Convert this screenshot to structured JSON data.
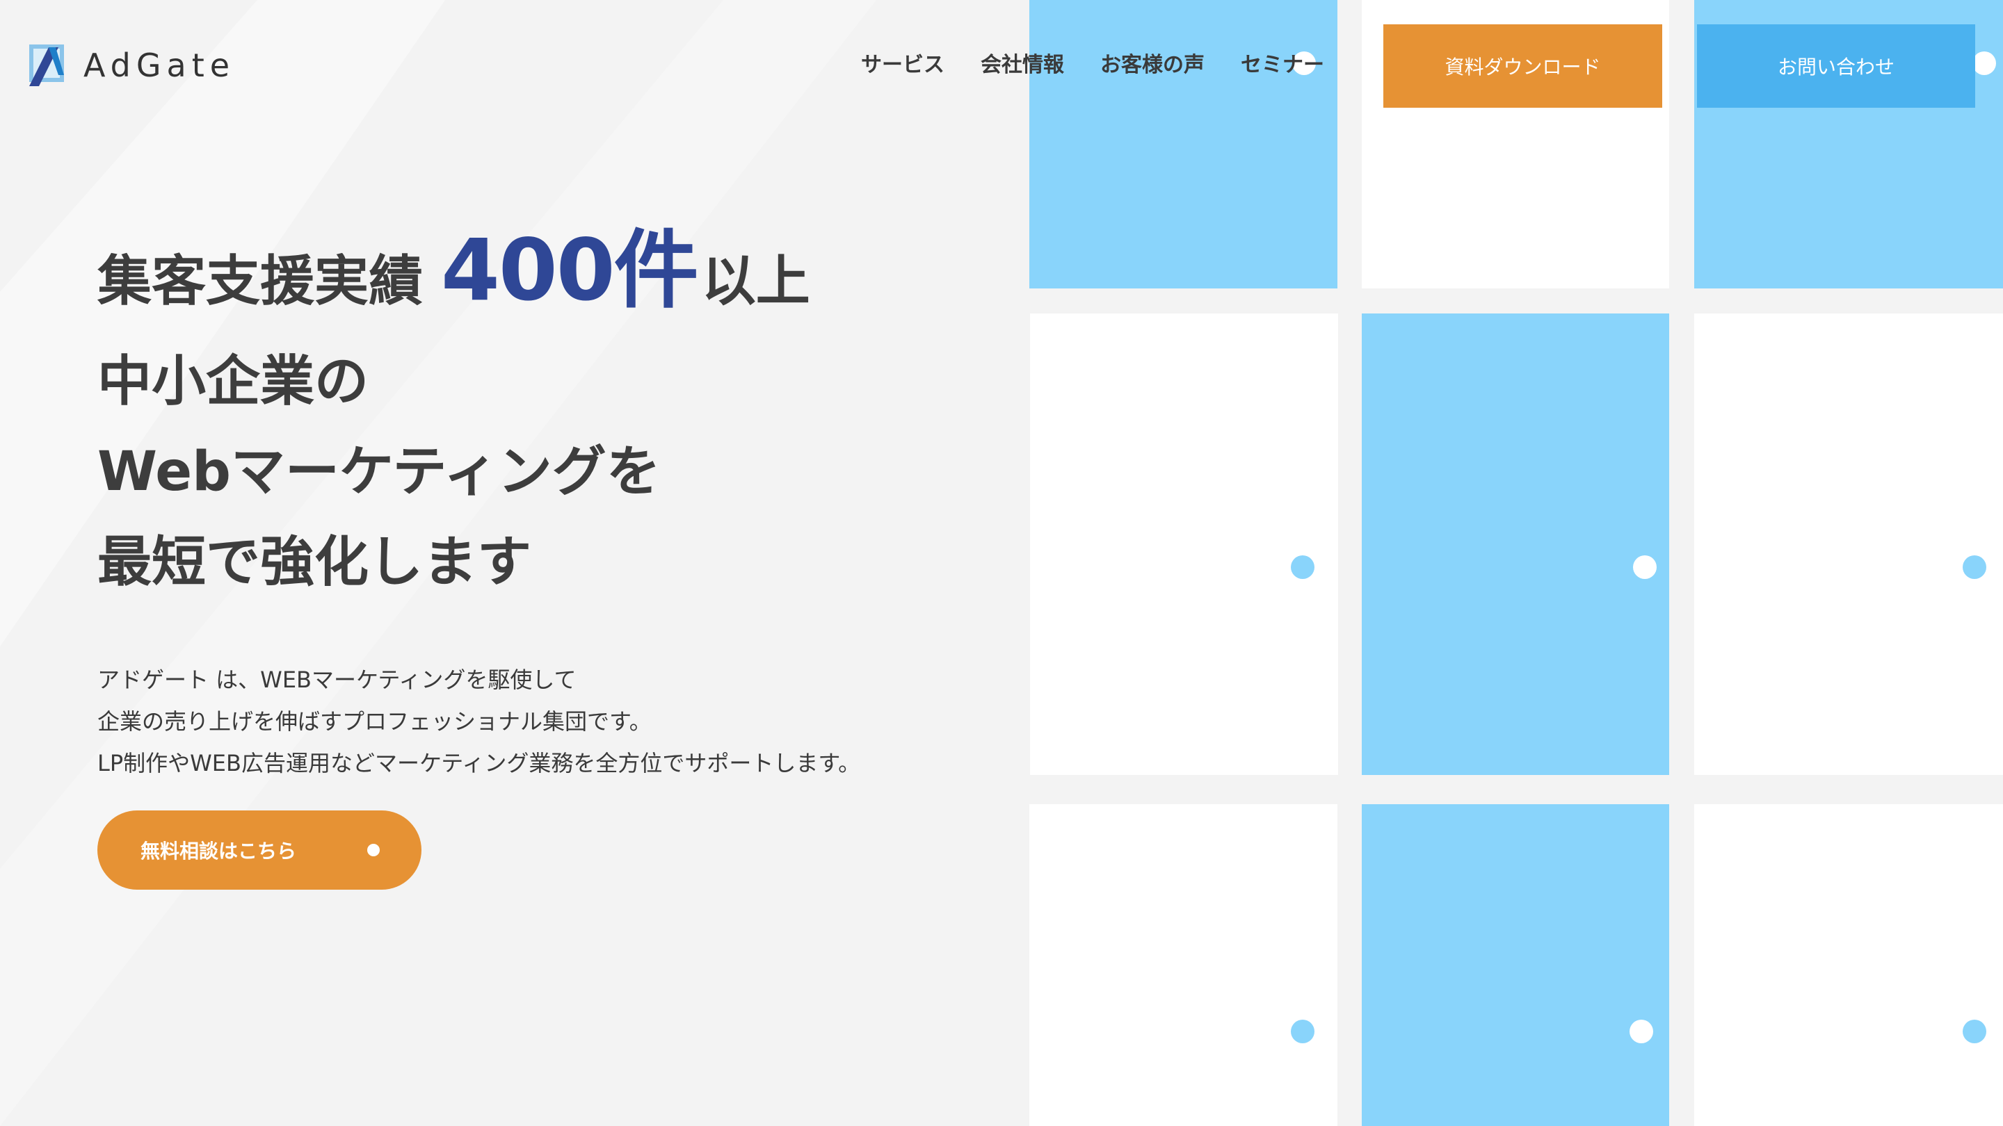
{
  "brand": {
    "name": "AdGate",
    "logo_icon": "adgate-logo-icon",
    "accent_color": "#2f4796",
    "orange": "#e69234",
    "blue": "#4bb2ef",
    "tile_blue": "#89d4fb"
  },
  "nav": {
    "items": [
      {
        "label": "サービス"
      },
      {
        "label": "会社情報"
      },
      {
        "label": "お客様の声"
      },
      {
        "label": "セミナー"
      }
    ],
    "download_label": "資料ダウンロード",
    "contact_label": "お問い合わせ"
  },
  "hero": {
    "line1_pre": "集客支援実績",
    "line1_accent": "400件",
    "line1_post": "以上",
    "line2": "中小企業の",
    "line3": "Webマーケティングを",
    "line4": "最短で強化します"
  },
  "description": {
    "lines": [
      "アドゲート は、WEBマーケティングを駆使して",
      "企業の売り上げを伸ばすプロフェッショナル集団です。",
      "LP制作やWEB広告運用などマーケティング業務を全方位でサポートします。"
    ]
  },
  "cta": {
    "label": "無料相談はこちら"
  }
}
